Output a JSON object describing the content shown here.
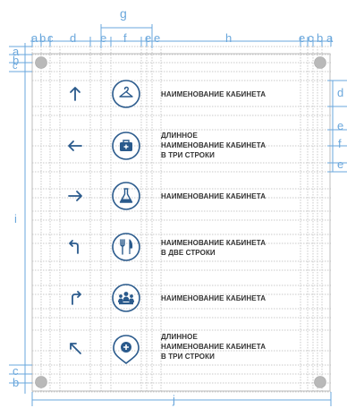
{
  "colors": {
    "dimension": "#6aa7dc",
    "guide": "#c9c9c9",
    "icon": "#2a5a8c",
    "text": "#333333",
    "screw": "#b9b9b9"
  },
  "dimension_labels": {
    "top_row": [
      "a",
      "b",
      "c",
      "d",
      "e",
      "f",
      "e",
      "e",
      "h",
      "e",
      "c",
      "b",
      "a"
    ],
    "top_span": "g",
    "left_column": [
      "a",
      "b",
      "c",
      "i",
      "c",
      "b"
    ],
    "right_column": [
      "d",
      "e",
      "f",
      "e"
    ],
    "bottom": "j"
  },
  "rows": [
    {
      "arrow": "arrow-up",
      "icon": "hanger",
      "lines": [
        "НАИМЕНОВАНИЕ КАБИНЕТА"
      ]
    },
    {
      "arrow": "arrow-left",
      "icon": "first-aid-kit",
      "lines": [
        "ДЛИННОЕ",
        "НАИМЕНОВАНИЕ КАБИНЕТА",
        "В ТРИ СТРОКИ"
      ]
    },
    {
      "arrow": "arrow-right",
      "icon": "flask",
      "lines": [
        "НАИМЕНОВАНИЕ КАБИНЕТА"
      ]
    },
    {
      "arrow": "arrow-turn-left",
      "icon": "fork-knife",
      "lines": [
        "НАИМЕНОВАНИЕ КАБИНЕТА",
        "В ДВЕ СТРОКИ"
      ]
    },
    {
      "arrow": "arrow-turn-right",
      "icon": "group",
      "lines": [
        "НАИМЕНОВАНИЕ КАБИНЕТА"
      ]
    },
    {
      "arrow": "arrow-up-left",
      "icon": "medical-pin",
      "lines": [
        "ДЛИННОЕ",
        "НАИМЕНОВАНИЕ КАБИНЕТА",
        "В ТРИ СТРОКИ"
      ]
    }
  ]
}
